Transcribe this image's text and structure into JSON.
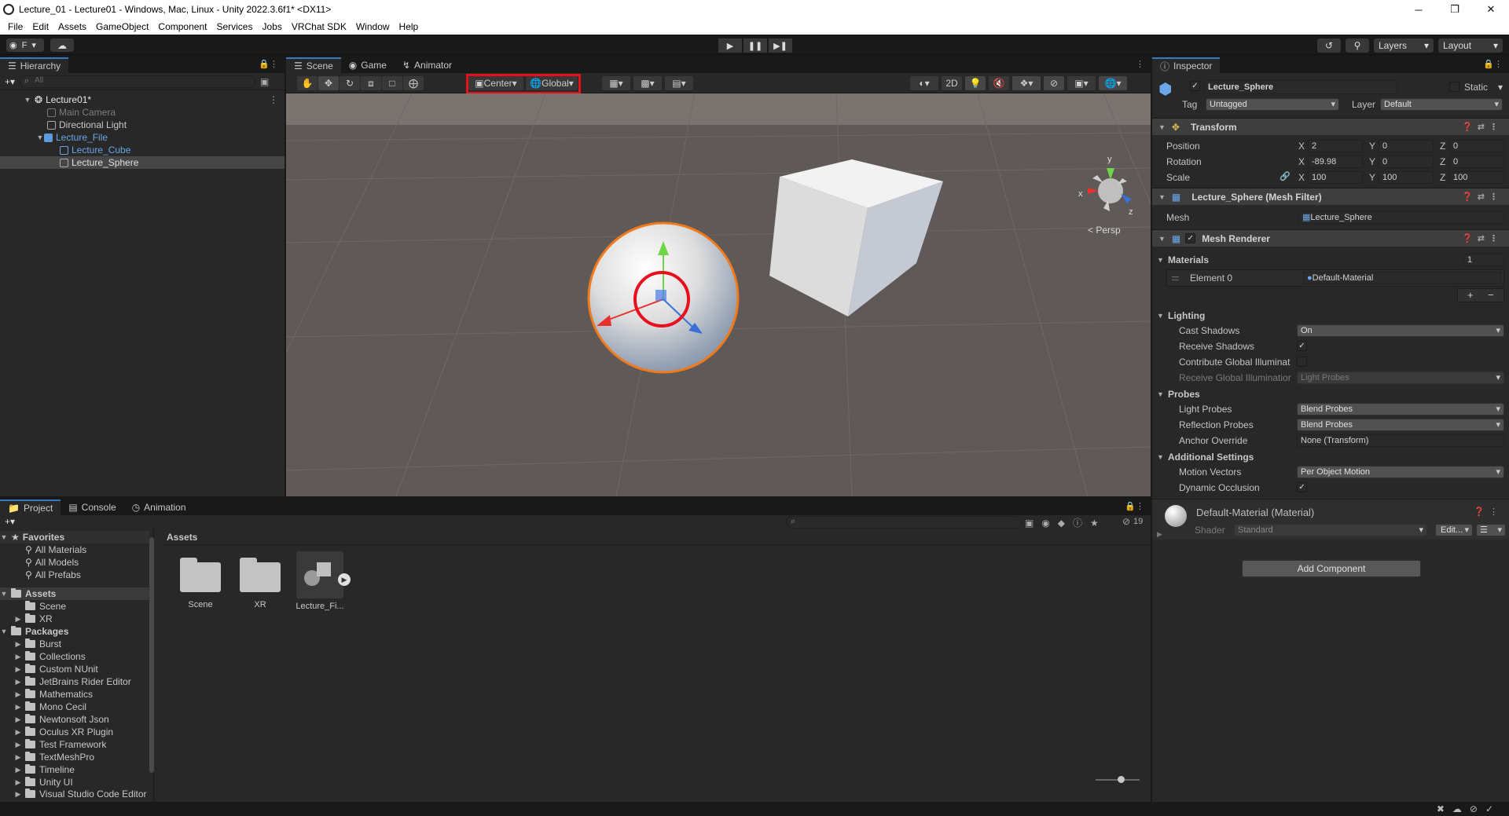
{
  "window": {
    "title": "Lecture_01 - Lecture01 - Windows, Mac, Linux - Unity 2022.3.6f1* <DX11>",
    "controls": [
      "─",
      "❐",
      "✕"
    ]
  },
  "menu": [
    "File",
    "Edit",
    "Assets",
    "GameObject",
    "Component",
    "Services",
    "Jobs",
    "VRChat SDK",
    "Window",
    "Help"
  ],
  "toolbar": {
    "account_label": "F",
    "layers_label": "Layers",
    "layout_label": "Layout"
  },
  "hierarchy": {
    "tab": "Hierarchy",
    "search_placeholder": "All",
    "items": [
      {
        "label": "Lecture01*"
      },
      {
        "label": "Main Camera"
      },
      {
        "label": "Directional Light"
      },
      {
        "label": "Lecture_File"
      },
      {
        "label": "Lecture_Cube"
      },
      {
        "label": "Lecture_Sphere"
      }
    ]
  },
  "scene": {
    "tabs": [
      "Scene",
      "Game",
      "Animator"
    ],
    "pivot_label": "Center",
    "space_label": "Global",
    "mode_2d": "2D",
    "persp_label": "Persp",
    "gizmo_axes": {
      "x": "x",
      "y": "y",
      "z": "z"
    }
  },
  "inspector": {
    "tab": "Inspector",
    "object_name": "Lecture_Sphere",
    "static_label": "Static",
    "tag_label": "Tag",
    "tag_value": "Untagged",
    "layer_label": "Layer",
    "layer_value": "Default",
    "transform": {
      "title": "Transform",
      "position_label": "Position",
      "rotation_label": "Rotation",
      "scale_label": "Scale",
      "axis": {
        "x": "X",
        "y": "Y",
        "z": "Z"
      },
      "position": {
        "x": "2",
        "y": "0",
        "z": "0"
      },
      "rotation": {
        "x": "-89.98",
        "y": "0",
        "z": "0"
      },
      "scale": {
        "x": "100",
        "y": "100",
        "z": "100"
      }
    },
    "mesh_filter": {
      "title": "Lecture_Sphere (Mesh Filter)",
      "mesh_label": "Mesh",
      "mesh_value": "Lecture_Sphere"
    },
    "mesh_renderer": {
      "title": "Mesh Renderer",
      "materials_label": "Materials",
      "materials_count": "1",
      "element0_label": "Element 0",
      "element0_value": "Default-Material",
      "lighting_label": "Lighting",
      "cast_shadows_label": "Cast Shadows",
      "cast_shadows_value": "On",
      "receive_shadows_label": "Receive Shadows",
      "contribute_gi_label": "Contribute Global Illuminat",
      "receive_gi_label": "Receive Global Illuminatior",
      "receive_gi_value": "Light Probes",
      "probes_label": "Probes",
      "light_probes_label": "Light Probes",
      "light_probes_value": "Blend Probes",
      "reflection_probes_label": "Reflection Probes",
      "reflection_probes_value": "Blend Probes",
      "anchor_override_label": "Anchor Override",
      "anchor_override_value": "None (Transform)",
      "additional_label": "Additional Settings",
      "motion_vectors_label": "Motion Vectors",
      "motion_vectors_value": "Per Object Motion",
      "dynamic_occlusion_label": "Dynamic Occlusion"
    },
    "material": {
      "title": "Default-Material (Material)",
      "shader_label": "Shader",
      "shader_value": "Standard",
      "edit_label": "Edit..."
    },
    "add_component_label": "Add Component"
  },
  "project": {
    "tabs": [
      "Project",
      "Console",
      "Animation"
    ],
    "hidden_count": "19",
    "favorites_label": "Favorites",
    "favorites": [
      "All Materials",
      "All Models",
      "All Prefabs"
    ],
    "assets_label": "Assets",
    "assets_children": [
      "Scene",
      "XR"
    ],
    "packages_label": "Packages",
    "packages": [
      "Burst",
      "Collections",
      "Custom NUnit",
      "JetBrains Rider Editor",
      "Mathematics",
      "Mono Cecil",
      "Newtonsoft Json",
      "Oculus XR Plugin",
      "Test Framework",
      "TextMeshPro",
      "Timeline",
      "Unity UI",
      "Visual Studio Code Editor"
    ],
    "breadcrumb": "Assets",
    "grid_items": [
      "Scene",
      "XR",
      "Lecture_Fi..."
    ]
  },
  "colors": {
    "highlight_red": "#e8101c",
    "selection_orange": "#f07a1c",
    "accent_blue": "#3a79bb",
    "prefab_blue": "#5d9bdc"
  }
}
